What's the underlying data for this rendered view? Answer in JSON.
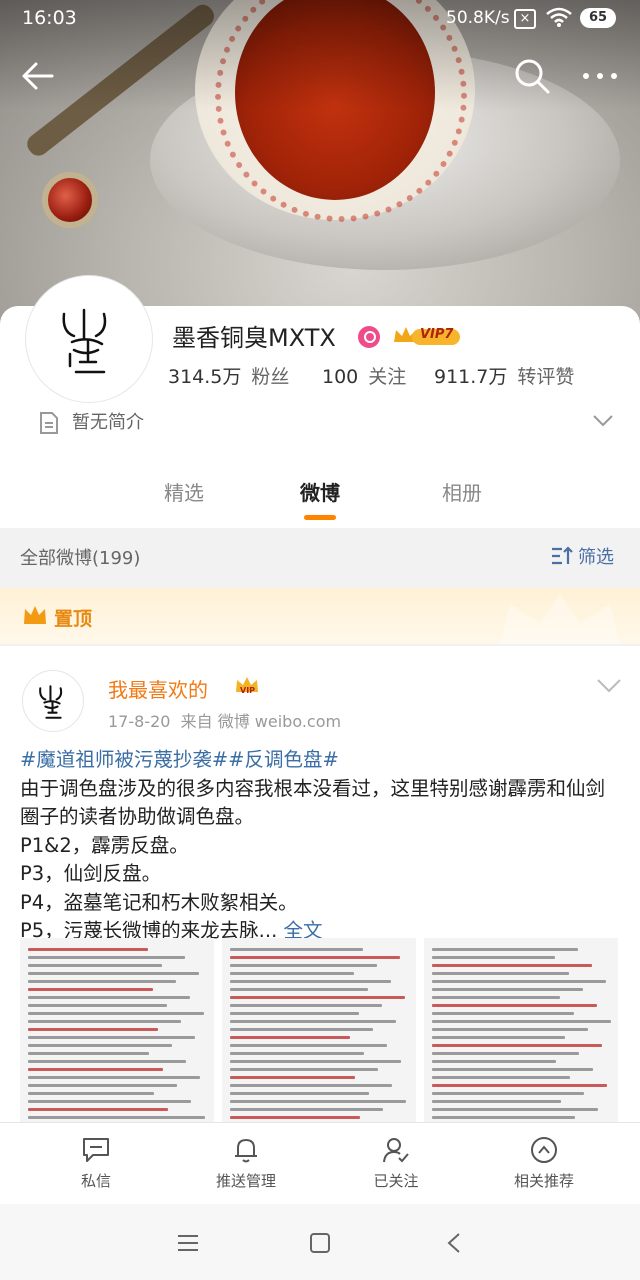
{
  "status": {
    "time": "16:03",
    "network": "50.8K/s",
    "battery": "65"
  },
  "profile": {
    "name": "墨香铜臭MXTX",
    "vip_level": "VIP7",
    "followers_value": "314.5万",
    "followers_label": "粉丝",
    "following_value": "100",
    "following_label": "关注",
    "reposts_value": "911.7万",
    "reposts_label": "转评赞",
    "intro": "暂无简介"
  },
  "tabs": [
    "精选",
    "微博",
    "相册"
  ],
  "active_tab": "微博",
  "list": {
    "all_label": "全部微博(199)",
    "filter_label": "筛选"
  },
  "pinned": {
    "label": "置顶"
  },
  "post": {
    "author": "我最喜欢的",
    "author_badge": "VIP",
    "date": "17-8-20",
    "source": "来自 微博 weibo.com",
    "tags": "#魔道祖师被污蔑抄袭##反调色盘#",
    "lines": [
      "由于调色盘涉及的很多内容我根本没看过，这里特别感谢霹雳和仙剑圈子的读者协助做调色盘。",
      "P1&2，霹雳反盘。",
      "P3，仙剑反盘。",
      "P4，盗墓笔记和朽木败絮相关。"
    ],
    "last_line": "P5，污蔑长微博的来龙去脉...",
    "more_label": "全文"
  },
  "actions": [
    "私信",
    "推送管理",
    "已关注",
    "相关推荐"
  ],
  "icons": [
    "back-arrow-icon",
    "search-icon",
    "more-icon",
    "doc-icon",
    "chevron-down-icon",
    "filter-icon",
    "crown-icon",
    "message-icon",
    "bell-icon",
    "user-followed-icon",
    "recommend-icon"
  ]
}
